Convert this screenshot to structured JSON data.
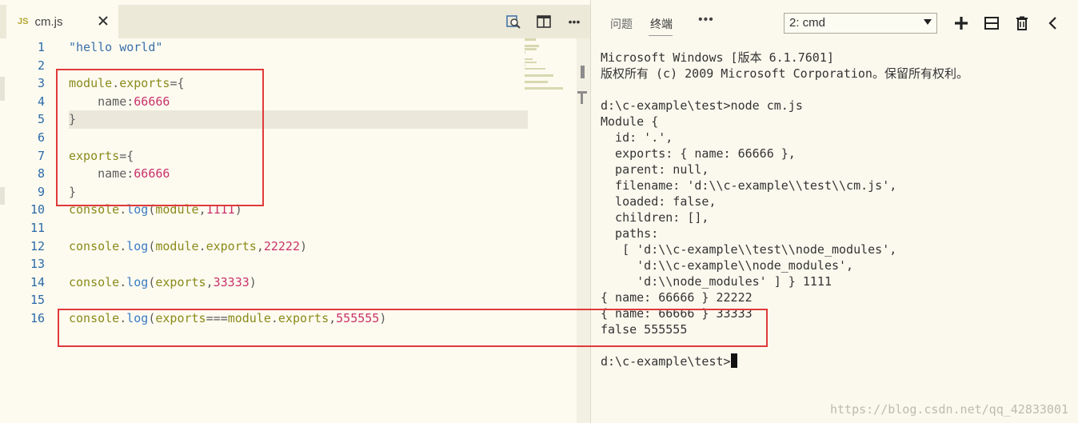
{
  "editor": {
    "tab": {
      "icon": "JS",
      "filename": "cm.js",
      "close_icon": "close-icon"
    },
    "actions": [
      "open-preview-icon",
      "split-editor-icon",
      "more-actions-icon"
    ],
    "more_label": "•••",
    "line_numbers": [
      "1",
      "2",
      "3",
      "4",
      "5",
      "6",
      "7",
      "8",
      "9",
      "10",
      "11",
      "12",
      "13",
      "14",
      "15",
      "16"
    ],
    "code": [
      [
        {
          "t": "str",
          "v": "\"hello world\""
        }
      ],
      [],
      [
        {
          "t": "id",
          "v": "module"
        },
        {
          "t": "punc",
          "v": "."
        },
        {
          "t": "id",
          "v": "exports"
        },
        {
          "t": "punc",
          "v": "={"
        }
      ],
      [
        {
          "t": "plain",
          "v": "    name:"
        },
        {
          "t": "num",
          "v": "66666"
        }
      ],
      [
        {
          "t": "punc",
          "v": "}"
        }
      ],
      [],
      [
        {
          "t": "id",
          "v": "exports"
        },
        {
          "t": "punc",
          "v": "={"
        }
      ],
      [
        {
          "t": "plain",
          "v": "    name:"
        },
        {
          "t": "num",
          "v": "66666"
        }
      ],
      [
        {
          "t": "punc",
          "v": "}"
        }
      ],
      [
        {
          "t": "id",
          "v": "console"
        },
        {
          "t": "punc",
          "v": "."
        },
        {
          "t": "fn",
          "v": "log"
        },
        {
          "t": "punc",
          "v": "("
        },
        {
          "t": "id",
          "v": "module"
        },
        {
          "t": "punc",
          "v": ","
        },
        {
          "t": "num",
          "v": "1111"
        },
        {
          "t": "punc",
          "v": ")"
        }
      ],
      [],
      [
        {
          "t": "id",
          "v": "console"
        },
        {
          "t": "punc",
          "v": "."
        },
        {
          "t": "fn",
          "v": "log"
        },
        {
          "t": "punc",
          "v": "("
        },
        {
          "t": "id",
          "v": "module"
        },
        {
          "t": "punc",
          "v": "."
        },
        {
          "t": "id",
          "v": "exports"
        },
        {
          "t": "punc",
          "v": ","
        },
        {
          "t": "num",
          "v": "22222"
        },
        {
          "t": "punc",
          "v": ")"
        }
      ],
      [],
      [
        {
          "t": "id",
          "v": "console"
        },
        {
          "t": "punc",
          "v": "."
        },
        {
          "t": "fn",
          "v": "log"
        },
        {
          "t": "punc",
          "v": "("
        },
        {
          "t": "id",
          "v": "exports"
        },
        {
          "t": "punc",
          "v": ","
        },
        {
          "t": "num",
          "v": "33333"
        },
        {
          "t": "punc",
          "v": ")"
        }
      ],
      [],
      [
        {
          "t": "id",
          "v": "console"
        },
        {
          "t": "punc",
          "v": "."
        },
        {
          "t": "fn",
          "v": "log"
        },
        {
          "t": "punc",
          "v": "("
        },
        {
          "t": "id",
          "v": "exports"
        },
        {
          "t": "punc",
          "v": "==="
        },
        {
          "t": "id",
          "v": "module"
        },
        {
          "t": "punc",
          "v": "."
        },
        {
          "t": "id",
          "v": "exports"
        },
        {
          "t": "punc",
          "v": ","
        },
        {
          "t": "num",
          "v": "555555"
        },
        {
          "t": "punc",
          "v": ")"
        }
      ]
    ]
  },
  "terminal": {
    "tabs": {
      "problems": "问题",
      "terminal": "终端"
    },
    "more_label": "•••",
    "selected_shell": "2: cmd",
    "actions": [
      "add-icon",
      "split-icon",
      "trash-icon",
      "chevron-left-icon",
      "maximize-icon"
    ],
    "output": [
      "Microsoft Windows [版本 6.1.7601]",
      "版权所有 (c) 2009 Microsoft Corporation。保留所有权利。",
      "",
      "d:\\c-example\\test>node cm.js",
      "Module {",
      "  id: '.',",
      "  exports: { name: 66666 },",
      "  parent: null,",
      "  filename: 'd:\\\\c-example\\\\test\\\\cm.js',",
      "  loaded: false,",
      "  children: [],",
      "  paths:",
      "   [ 'd:\\\\c-example\\\\test\\\\node_modules',",
      "     'd:\\\\c-example\\\\node_modules',",
      "     'd:\\\\node_modules' ] } 1111",
      "{ name: 66666 } 22222",
      "{ name: 66666 } 33333",
      "false 555555",
      ""
    ],
    "prompt": "d:\\c-example\\test>"
  },
  "watermark": "https://blog.csdn.net/qq_42833001",
  "colors": {
    "annotation_red": "#e03a3a",
    "string": "#3a6fa8",
    "identifier": "#8a8a1a",
    "number": "#c9316a",
    "function": "#3b7cc4"
  }
}
